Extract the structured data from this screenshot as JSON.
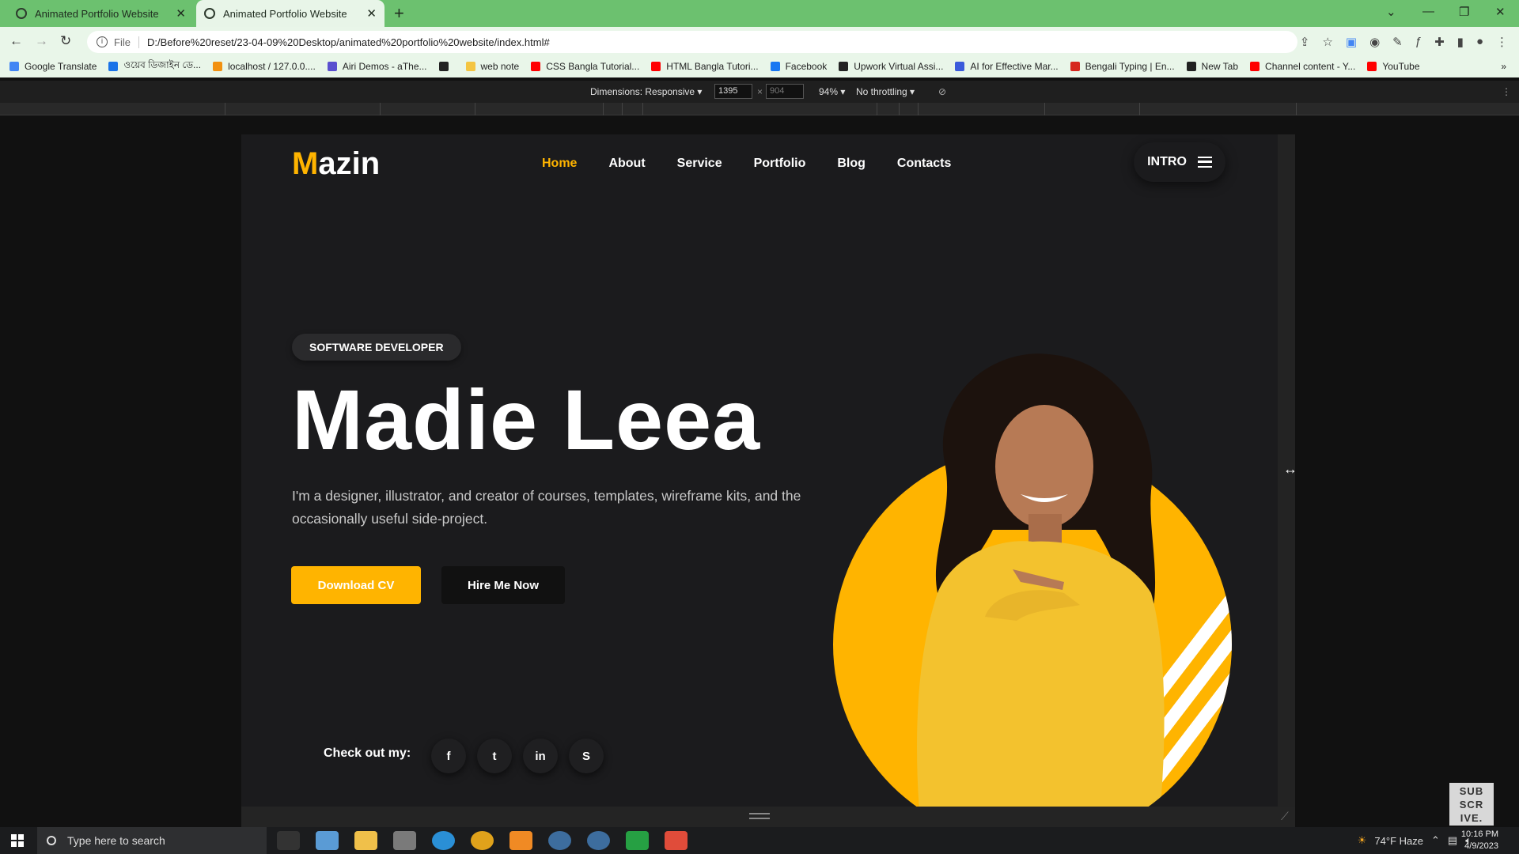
{
  "browser": {
    "tabs": [
      {
        "title": "Animated Portfolio Website"
      },
      {
        "title": "Animated Portfolio Website"
      }
    ],
    "url_prefix": "File",
    "url": "D:/Before%20reset/23-04-09%20Desktop/animated%20portfolio%20website/index.html#",
    "bookmarks": [
      {
        "label": "Google Translate",
        "color": "#4285f4"
      },
      {
        "label": "ওয়েব ডিজাইন ডে...",
        "color": "#1a73e8"
      },
      {
        "label": "localhost / 127.0.0....",
        "color": "#f29111"
      },
      {
        "label": "Airi Demos - aThe...",
        "color": "#5a4fcf"
      },
      {
        "label": "",
        "color": "#222222"
      },
      {
        "label": "web note",
        "color": "#f4c542"
      },
      {
        "label": "CSS Bangla Tutorial...",
        "color": "#ff0000"
      },
      {
        "label": "HTML Bangla Tutori...",
        "color": "#ff0000"
      },
      {
        "label": "Facebook",
        "color": "#1877f2"
      },
      {
        "label": "Upwork Virtual Assi...",
        "color": "#222222"
      },
      {
        "label": "AI for Effective Mar...",
        "color": "#3b5bdb"
      },
      {
        "label": "Bengali Typing | En...",
        "color": "#d6281f"
      },
      {
        "label": "New Tab",
        "color": "#222222"
      },
      {
        "label": "Channel content - Y...",
        "color": "#ff0000"
      },
      {
        "label": "YouTube",
        "color": "#ff0000"
      }
    ]
  },
  "devtools": {
    "dimensions_label": "Dimensions: Responsive ▾",
    "width": "1395",
    "height": "904",
    "zoom": "94% ▾",
    "throttling": "No throttling ▾"
  },
  "site": {
    "logo_initial": "M",
    "logo_rest": "azin",
    "nav": [
      "Home",
      "About",
      "Service",
      "Portfolio",
      "Blog",
      "Contacts"
    ],
    "intro_label": "INTRO",
    "role_badge": "SOFTWARE DEVELOPER",
    "name": "Madie Leea",
    "description": "I'm a designer, illustrator, and creator of courses, templates, wireframe kits, and the occasionally useful side-project.",
    "download_cv": "Download CV",
    "hire_me": "Hire Me Now",
    "social_label": "Check out my:",
    "socials": [
      "f",
      "t",
      "in",
      "S"
    ],
    "accent_color": "#ffb400"
  },
  "overlay": {
    "subscribe_lines": [
      "SUB",
      "SCR",
      "IVE."
    ]
  },
  "taskbar": {
    "search_placeholder": "Type here to search",
    "weather": "74°F  Haze",
    "time": "10:16 PM",
    "date": "4/9/2023"
  }
}
